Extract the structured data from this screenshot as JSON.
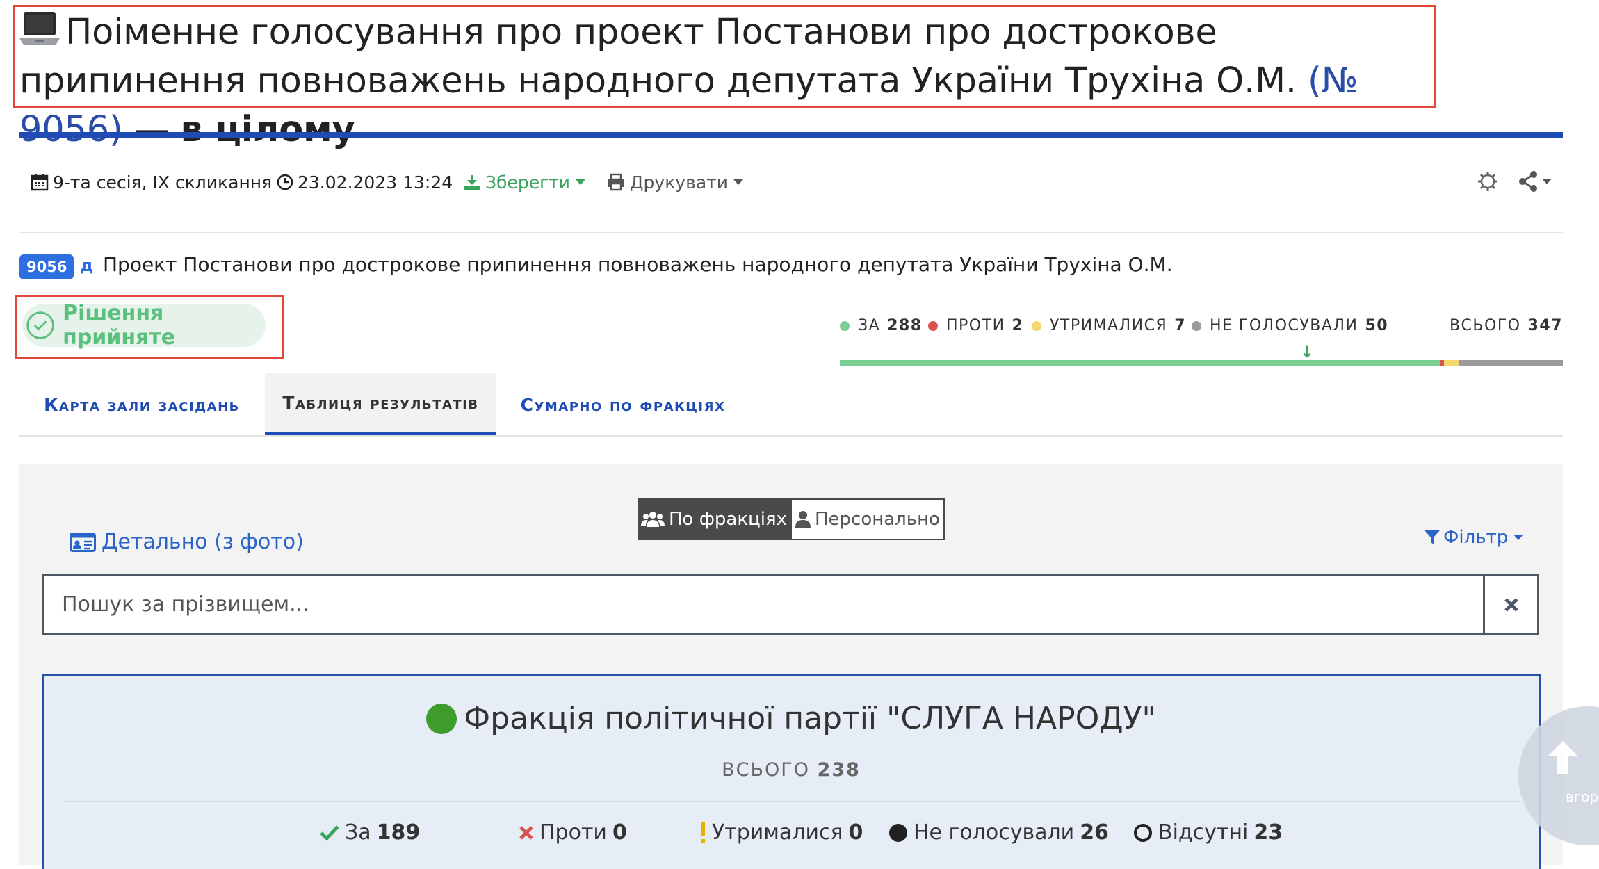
{
  "header": {
    "title_main": "Поіменне голосування про проект Постанови про дострокове припинення повноважень народного депутата України Трухіна О.М.",
    "title_number": "(№ 9056)",
    "title_dash": "—",
    "title_scope": "в цілому"
  },
  "toolbar": {
    "session": "9-та сесія, IX скликання",
    "datetime": "23.02.2023 13:24",
    "save_label": "Зберегти",
    "print_label": "Друкувати"
  },
  "bill": {
    "number": "9056",
    "type_letter": "д",
    "title": "Проект Постанови про дострокове припинення повноважень народного депутата України Трухіна О.М."
  },
  "decision": {
    "label": "Рішення прийняте"
  },
  "summary": {
    "for_label": "ЗА",
    "for_value": "288",
    "against_label": "ПРОТИ",
    "against_value": "2",
    "abstain_label": "УТРИМАЛИСЯ",
    "abstain_value": "7",
    "notvoted_label": "НЕ ГОЛОСУВАЛИ",
    "notvoted_value": "50",
    "total_label": "ВСЬОГО",
    "total_value": "347",
    "colors": {
      "for": "#7ccf94",
      "against": "#d9534f",
      "abstain": "#f5d76e",
      "notvoted": "#9a9a9a"
    }
  },
  "tabs": [
    {
      "label": "Карта зали засідань"
    },
    {
      "label": "Таблиця результатів"
    },
    {
      "label": "Сумарно по фракціях"
    }
  ],
  "view": {
    "by_faction": "По фракціях",
    "personal": "Персонально",
    "detail_link": "Детально (з фото)",
    "filter": "Фільтр",
    "search_placeholder": "Пошук за прізвищем..."
  },
  "faction": {
    "name": "Фракція політичної партії \"СЛУГА НАРОДУ\"",
    "total_label": "ВСЬОГО",
    "total_value": "238",
    "stats": {
      "for_label": "За",
      "for_value": "189",
      "against_label": "Проти",
      "against_value": "0",
      "abstain_label": "Утрималися",
      "abstain_value": "0",
      "notvoted_label": "Не голосували",
      "notvoted_value": "26",
      "absent_label": "Відсутні",
      "absent_value": "23"
    }
  },
  "back_to_top": {
    "label": "вгор"
  }
}
